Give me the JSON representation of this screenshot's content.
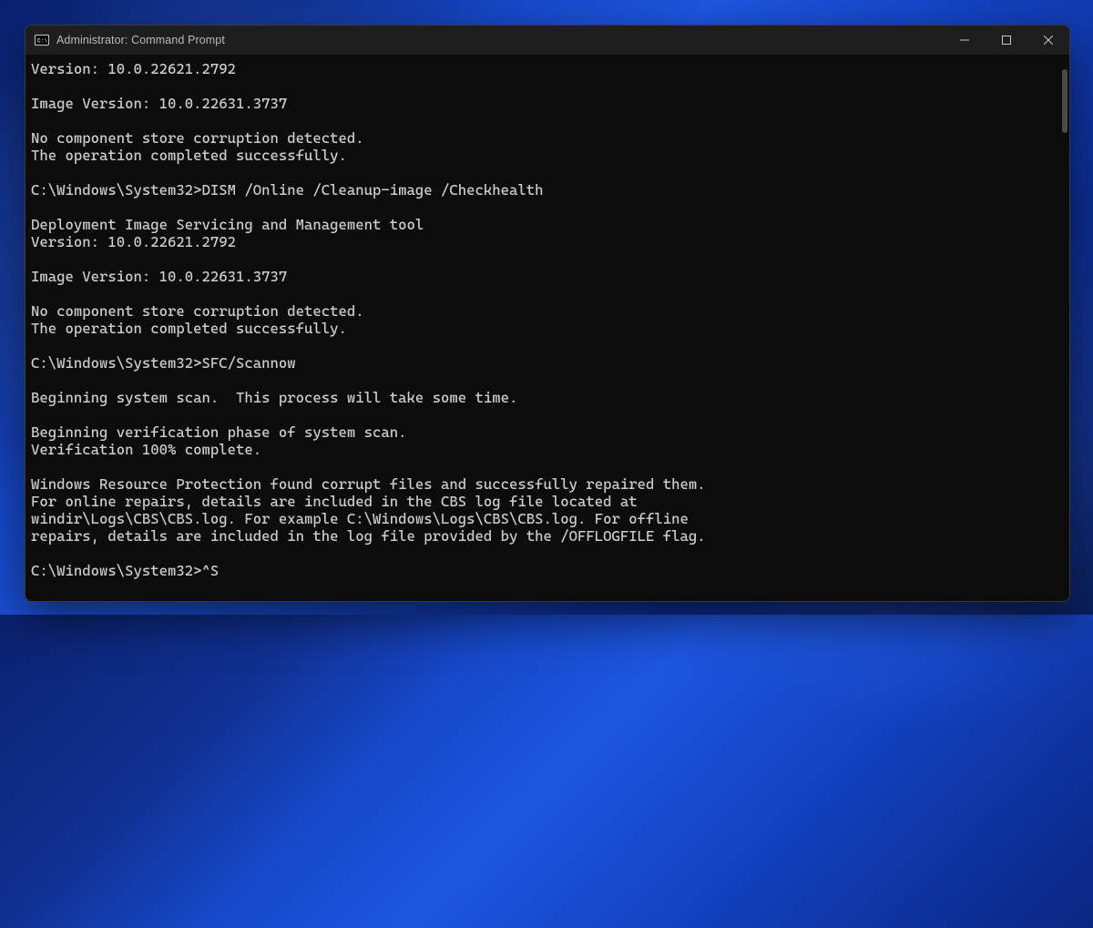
{
  "window": {
    "title": "Administrator: Command Prompt"
  },
  "terminal": {
    "lines": [
      "Version: 10.0.22621.2792",
      "",
      "Image Version: 10.0.22631.3737",
      "",
      "No component store corruption detected.",
      "The operation completed successfully.",
      "",
      "C:\\Windows\\System32>DISM /Online /Cleanup-image /Checkhealth",
      "",
      "Deployment Image Servicing and Management tool",
      "Version: 10.0.22621.2792",
      "",
      "Image Version: 10.0.22631.3737",
      "",
      "No component store corruption detected.",
      "The operation completed successfully.",
      "",
      "C:\\Windows\\System32>SFC/Scannow",
      "",
      "Beginning system scan.  This process will take some time.",
      "",
      "Beginning verification phase of system scan.",
      "Verification 100% complete.",
      "",
      "Windows Resource Protection found corrupt files and successfully repaired them.",
      "For online repairs, details are included in the CBS log file located at",
      "windir\\Logs\\CBS\\CBS.log. For example C:\\Windows\\Logs\\CBS\\CBS.log. For offline",
      "repairs, details are included in the log file provided by the /OFFLOGFILE flag.",
      "",
      "C:\\Windows\\System32>^S"
    ]
  }
}
